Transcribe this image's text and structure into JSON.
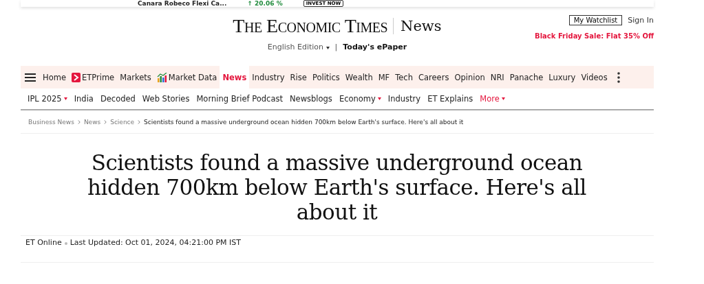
{
  "ad_strip": {
    "fund": "Canara Robeco Flexi Ca...",
    "return": "↑ 20.06 %",
    "button": "INVEST NOW"
  },
  "header": {
    "logo": "The Economic Times",
    "section": "News",
    "edition": "English Edition",
    "separator": "|",
    "epaper": "Today's ePaper",
    "watchlist": "My Watchlist",
    "sign_in": "Sign In",
    "promo": "Black Friday Sale: Flat 35% Off"
  },
  "main_nav": [
    {
      "label": "Home",
      "selected": false,
      "kind": "text"
    },
    {
      "label": "ETPrime",
      "selected": false,
      "kind": "prime"
    },
    {
      "label": "Markets",
      "selected": false,
      "kind": "text"
    },
    {
      "label": "Market Data",
      "selected": false,
      "kind": "chart"
    },
    {
      "label": "News",
      "selected": true,
      "kind": "text"
    },
    {
      "label": "Industry",
      "selected": false,
      "kind": "text"
    },
    {
      "label": "Rise",
      "selected": false,
      "kind": "text"
    },
    {
      "label": "Politics",
      "selected": false,
      "kind": "text"
    },
    {
      "label": "Wealth",
      "selected": false,
      "kind": "text"
    },
    {
      "label": "MF",
      "selected": false,
      "kind": "text"
    },
    {
      "label": "Tech",
      "selected": false,
      "kind": "text"
    },
    {
      "label": "Careers",
      "selected": false,
      "kind": "text"
    },
    {
      "label": "Opinion",
      "selected": false,
      "kind": "text"
    },
    {
      "label": "NRI",
      "selected": false,
      "kind": "text"
    },
    {
      "label": "Panache",
      "selected": false,
      "kind": "text"
    },
    {
      "label": "Luxury",
      "selected": false,
      "kind": "text"
    },
    {
      "label": "Videos",
      "selected": false,
      "kind": "text"
    }
  ],
  "sub_nav": [
    {
      "label": "IPL 2025",
      "dropdown": true,
      "highlighted": false
    },
    {
      "label": "India",
      "dropdown": false,
      "highlighted": false
    },
    {
      "label": "Decoded",
      "dropdown": false,
      "highlighted": false
    },
    {
      "label": "Web Stories",
      "dropdown": false,
      "highlighted": false
    },
    {
      "label": "Morning Brief Podcast",
      "dropdown": false,
      "highlighted": false
    },
    {
      "label": "Newsblogs",
      "dropdown": false,
      "highlighted": false
    },
    {
      "label": "Economy",
      "dropdown": true,
      "highlighted": false
    },
    {
      "label": "Industry",
      "dropdown": false,
      "highlighted": false
    },
    {
      "label": "ET Explains",
      "dropdown": false,
      "highlighted": false
    },
    {
      "label": "More",
      "dropdown": true,
      "highlighted": true
    }
  ],
  "breadcrumbs": [
    "Business News",
    "News",
    "Science",
    "Scientists found a massive underground ocean hidden 700km below Earth's surface. Here's all about it"
  ],
  "article": {
    "headline": "Scientists found a massive underground ocean hidden 700km below Earth's surface. Here's all about it",
    "byline": "ET Online",
    "updated": "Last Updated: Oct 01, 2024, 04:21:00 PM IST"
  }
}
